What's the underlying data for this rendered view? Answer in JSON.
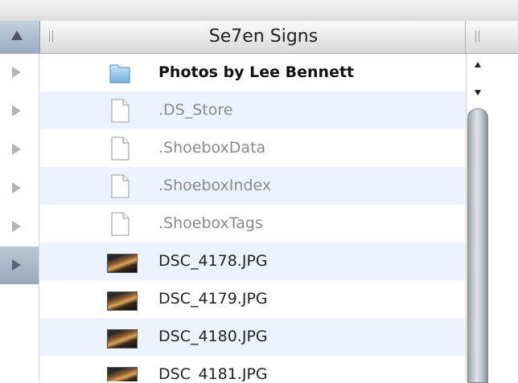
{
  "column": {
    "title": "Se7en Signs"
  },
  "rows": [
    {
      "label": "Photos by Lee Bennett",
      "icon": "folder-icon",
      "style": "bold"
    },
    {
      "label": ".DS_Store",
      "icon": "document-icon",
      "style": "dim"
    },
    {
      "label": ".ShoeboxData",
      "icon": "document-icon",
      "style": "dim"
    },
    {
      "label": ".ShoeboxIndex",
      "icon": "document-icon",
      "style": "dim"
    },
    {
      "label": ".ShoeboxTags",
      "icon": "document-icon",
      "style": "dim"
    },
    {
      "label": "DSC_4178.JPG",
      "icon": "photo-thumbnail-icon",
      "style": "normal"
    },
    {
      "label": "DSC_4179.JPG",
      "icon": "photo-thumbnail-icon",
      "style": "normal"
    },
    {
      "label": "DSC_4180.JPG",
      "icon": "photo-thumbnail-icon",
      "style": "normal"
    },
    {
      "label": "DSC_4181.JPG",
      "icon": "photo-thumbnail-icon",
      "style": "normal"
    }
  ],
  "colors": {
    "alt_row": "#edf3fe",
    "header_sort": "#98abc1",
    "dim_text": "#8a8a8a"
  }
}
